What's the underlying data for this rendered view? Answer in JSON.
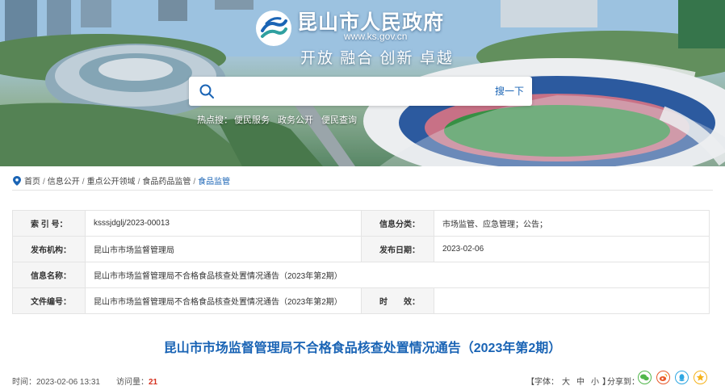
{
  "header": {
    "site_title": "昆山市人民政府",
    "site_url": "www.ks.gov.cn",
    "slogan": "开放  融合  创新  卓越",
    "search": {
      "placeholder": "",
      "button_label": "搜一下"
    },
    "hot_label": "热点搜：",
    "hot_links": [
      "便民服务",
      "政务公开",
      "便民查询"
    ]
  },
  "breadcrumb": {
    "items": [
      "首页",
      "信息公开",
      "重点公开领域",
      "食品药品监管"
    ],
    "current": "食品监管"
  },
  "info": {
    "index_label": "索 引 号：",
    "index_value": "ksssjdglj/2023-00013",
    "category_label": "信息分类：",
    "category_value": "市场监管、应急管理；公告；",
    "publisher_label": "发布机构：",
    "publisher_value": "昆山市市场监督管理局",
    "date_label": "发布日期：",
    "date_value": "2023-02-06",
    "name_label": "信息名称：",
    "name_value": "昆山市市场监督管理局不合格食品核查处置情况通告（2023年第2期）",
    "file_label": "文件编号：",
    "file_value": "昆山市市场监督管理局不合格食品核查处置情况通告（2023年第2期）",
    "validity_label": "时　　效：",
    "validity_value": ""
  },
  "article": {
    "title": "昆山市市场监督管理局不合格食品核查处置情况通告（2023年第2期）",
    "time_label": "时间：",
    "time_value": "2023-02-06 13:31",
    "views_label": "访问量：",
    "views_value": "21",
    "font_label": "【字体：",
    "font_large": "大",
    "font_medium": "中",
    "font_small": "小",
    "font_close": "】",
    "share_label": "分享到："
  },
  "colors": {
    "accent": "#1a64b5",
    "views": "#d5311f",
    "wechat": "#51b74b",
    "weibo": "#e85a2b",
    "qq": "#2fa7e2",
    "favorite": "#f5b21b"
  },
  "icons": [
    "logo-icon",
    "search-icon",
    "location-icon",
    "wechat-icon",
    "weibo-icon",
    "qq-icon",
    "star-icon"
  ]
}
